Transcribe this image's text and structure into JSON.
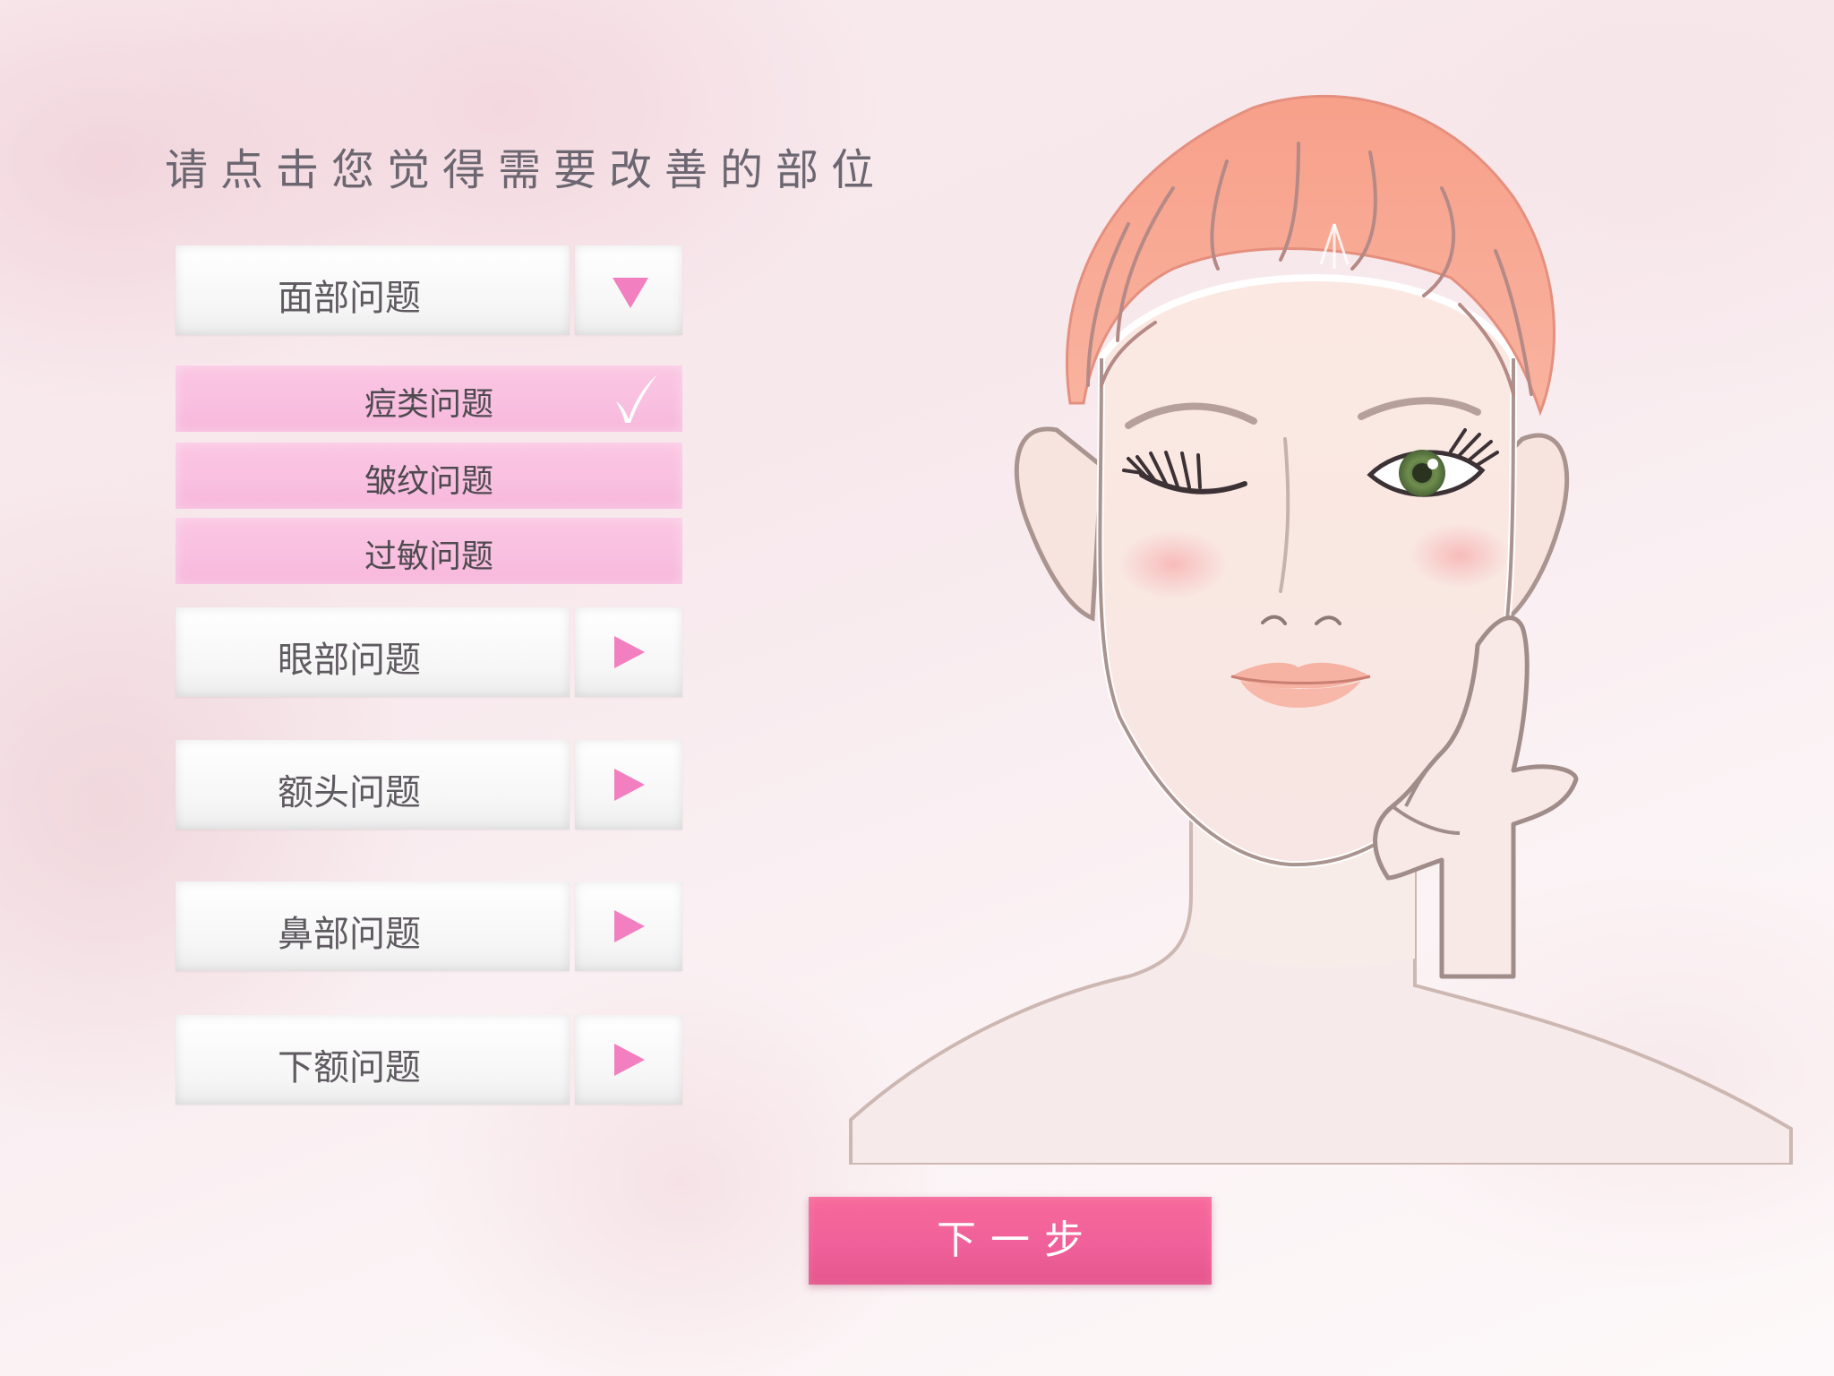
{
  "page": {
    "title": "请点击您觉得需要改善的部位"
  },
  "categories": [
    {
      "label": "面部问题",
      "expanded": true,
      "arrow": "triangle-down-icon"
    },
    {
      "label": "眼部问题",
      "expanded": false,
      "arrow": "triangle-right-icon"
    },
    {
      "label": "额头问题",
      "expanded": false,
      "arrow": "triangle-right-icon"
    },
    {
      "label": "鼻部问题",
      "expanded": false,
      "arrow": "triangle-right-icon"
    },
    {
      "label": "下额问题",
      "expanded": false,
      "arrow": "triangle-right-icon"
    }
  ],
  "face_subitems": [
    {
      "label": "痘类问题",
      "selected": true
    },
    {
      "label": "皱纹问题",
      "selected": false
    },
    {
      "label": "过敏问题",
      "selected": false
    }
  ],
  "next_button": {
    "label": "下一步"
  },
  "colors": {
    "accent_pink": "#f27fbf",
    "subitem_pink": "#f9bfe0",
    "button_pink": "#f0609a",
    "hair": "#f8a48c"
  }
}
